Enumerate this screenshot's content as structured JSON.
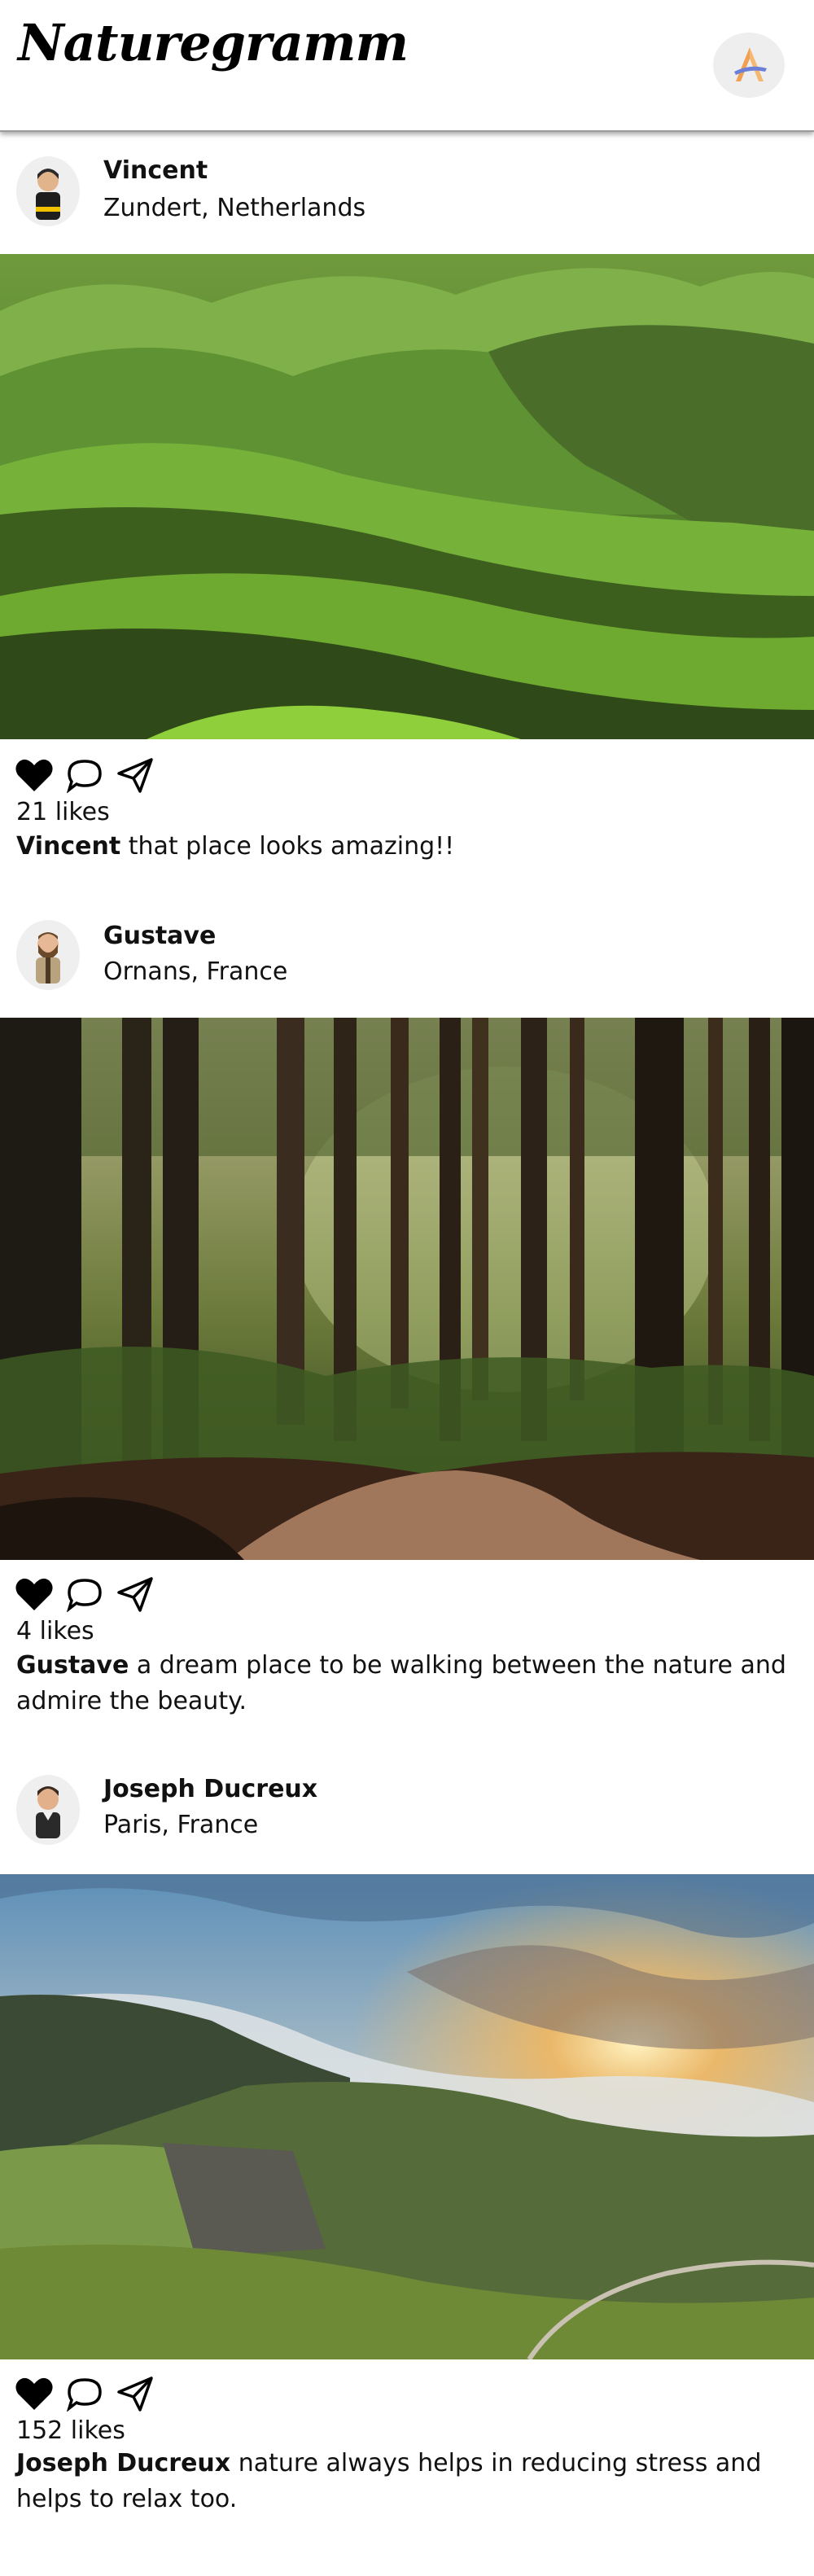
{
  "app": {
    "logo_text": "Naturegramm",
    "badge_icon": "app-logo-icon"
  },
  "posts": [
    {
      "user": "Vincent",
      "location": "Zundert, Netherlands",
      "photo": "rolling-green-hills",
      "likes": "21 likes",
      "caption_user": "Vincent",
      "caption_text": " that place looks amazing!!"
    },
    {
      "user": "Gustave",
      "location": "Ornans, France",
      "photo": "forest-path",
      "likes": "4 likes",
      "caption_user": "Gustave",
      "caption_text": " a dream place to be walking between the nature and admire the beauty."
    },
    {
      "user": "Joseph Ducreux",
      "location": "Paris, France",
      "photo": "misty-mountains-sunset",
      "likes": "152 likes",
      "caption_user": "Joseph Ducreux",
      "caption_text": " nature always helps in reducing stress and helps to relax too."
    }
  ],
  "icons": [
    "heart-icon",
    "comment-icon",
    "share-icon"
  ],
  "colors": {
    "accent_orange": "#f0a050",
    "accent_blue": "#6c7fd8"
  }
}
